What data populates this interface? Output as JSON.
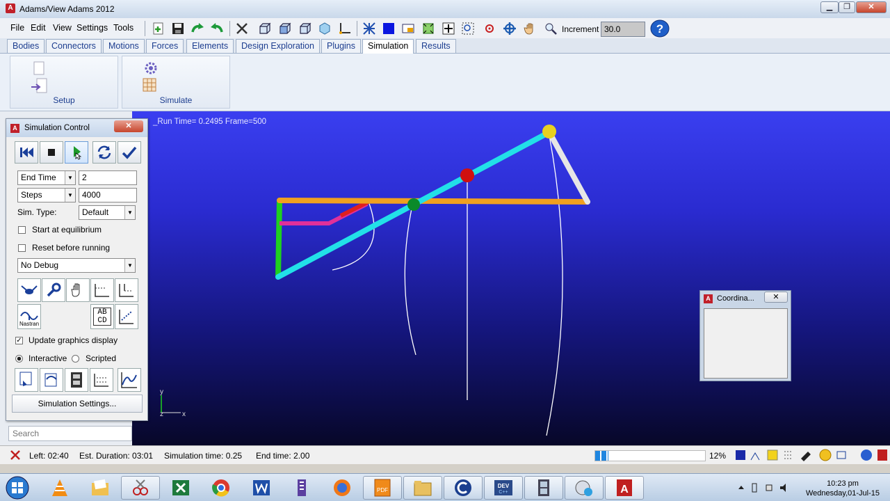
{
  "window": {
    "title": "Adams/View Adams 2012",
    "app_icon": "A"
  },
  "menu": {
    "items": [
      "File",
      "Edit",
      "View",
      "Settings",
      "Tools"
    ]
  },
  "toolbar": {
    "increment_label": "Increment",
    "increment_value": "30.0"
  },
  "tabs": [
    "Bodies",
    "Connectors",
    "Motions",
    "Forces",
    "Elements",
    "Design Exploration",
    "Plugins",
    "Simulation",
    "Results"
  ],
  "active_tab": "Simulation",
  "ribbon": {
    "groups": [
      "Setup",
      "Simulate"
    ]
  },
  "viewport": {
    "run_label": "_Run   Time=  0.2495  Frame=500",
    "axis_y": "y",
    "axis_z": "z",
    "axis_x": "x"
  },
  "sim_panel": {
    "title": "Simulation Control",
    "end_time_label": "End Time",
    "end_time_value": "2",
    "steps_label": "Steps",
    "steps_value": "4000",
    "sim_type_label": "Sim. Type:",
    "sim_type_value": "Default",
    "start_equilibrium": "Start at equilibrium",
    "reset_before": "Reset before running",
    "debug_value": "No Debug",
    "nastran_label": "Nastran",
    "abcd_label": "AB CD",
    "update_graphics": "Update graphics display",
    "interactive": "Interactive",
    "scripted": "Scripted",
    "settings_button": "Simulation Settings..."
  },
  "search": {
    "placeholder": "Search"
  },
  "status": {
    "left": "Left: 02:40",
    "duration": "Est. Duration: 03:01",
    "sim_time": "Simulation time: 0.25",
    "end_time": "End time: 2.00",
    "percent": "12%"
  },
  "coord_window": {
    "title": "Coordina...",
    "close": "✕"
  },
  "taskbar": {
    "time": "10:23 pm",
    "date": "Wednesday,01-Jul-15"
  }
}
